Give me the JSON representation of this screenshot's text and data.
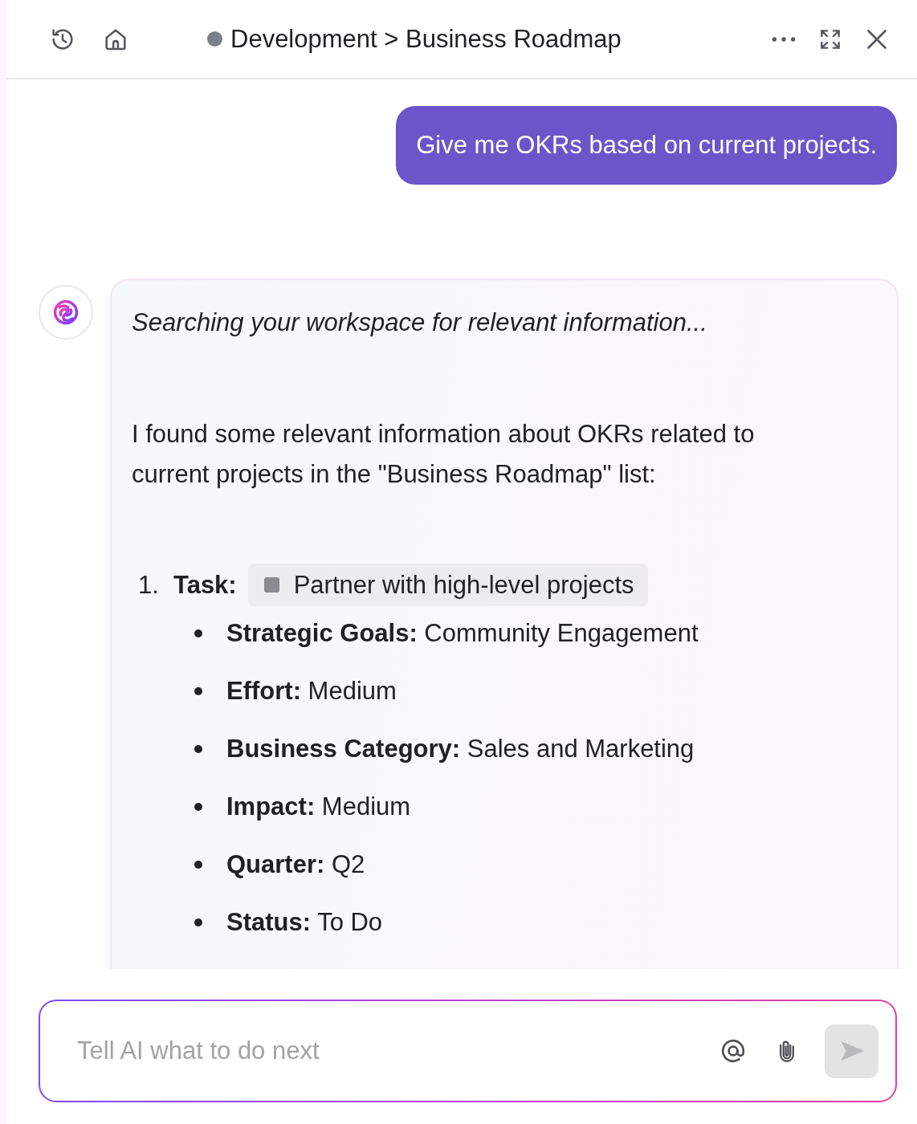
{
  "header": {
    "breadcrumb": "Development > Business Roadmap"
  },
  "messages": [
    {
      "kind": "user",
      "text": "Give me OKRs based on current projects."
    },
    {
      "kind": "assistant",
      "status": "Searching your workspace for relevant information...",
      "intro": "I found some relevant information about OKRs related to current projects in the \"Business Roadmap\" list:",
      "tasks": [
        {
          "number": "1.",
          "label": "Task:",
          "task_name": "Partner with high-level projects",
          "fields": [
            {
              "label": "Strategic Goals:",
              "value": "Community Engagement"
            },
            {
              "label": "Effort:",
              "value": "Medium"
            },
            {
              "label": "Business Category:",
              "value": "Sales and Marketing"
            },
            {
              "label": "Impact:",
              "value": "Medium"
            },
            {
              "label": "Quarter:",
              "value": "Q2"
            },
            {
              "label": "Status:",
              "value": "To Do"
            }
          ]
        }
      ]
    }
  ],
  "composer": {
    "placeholder": "Tell AI what to do next"
  }
}
